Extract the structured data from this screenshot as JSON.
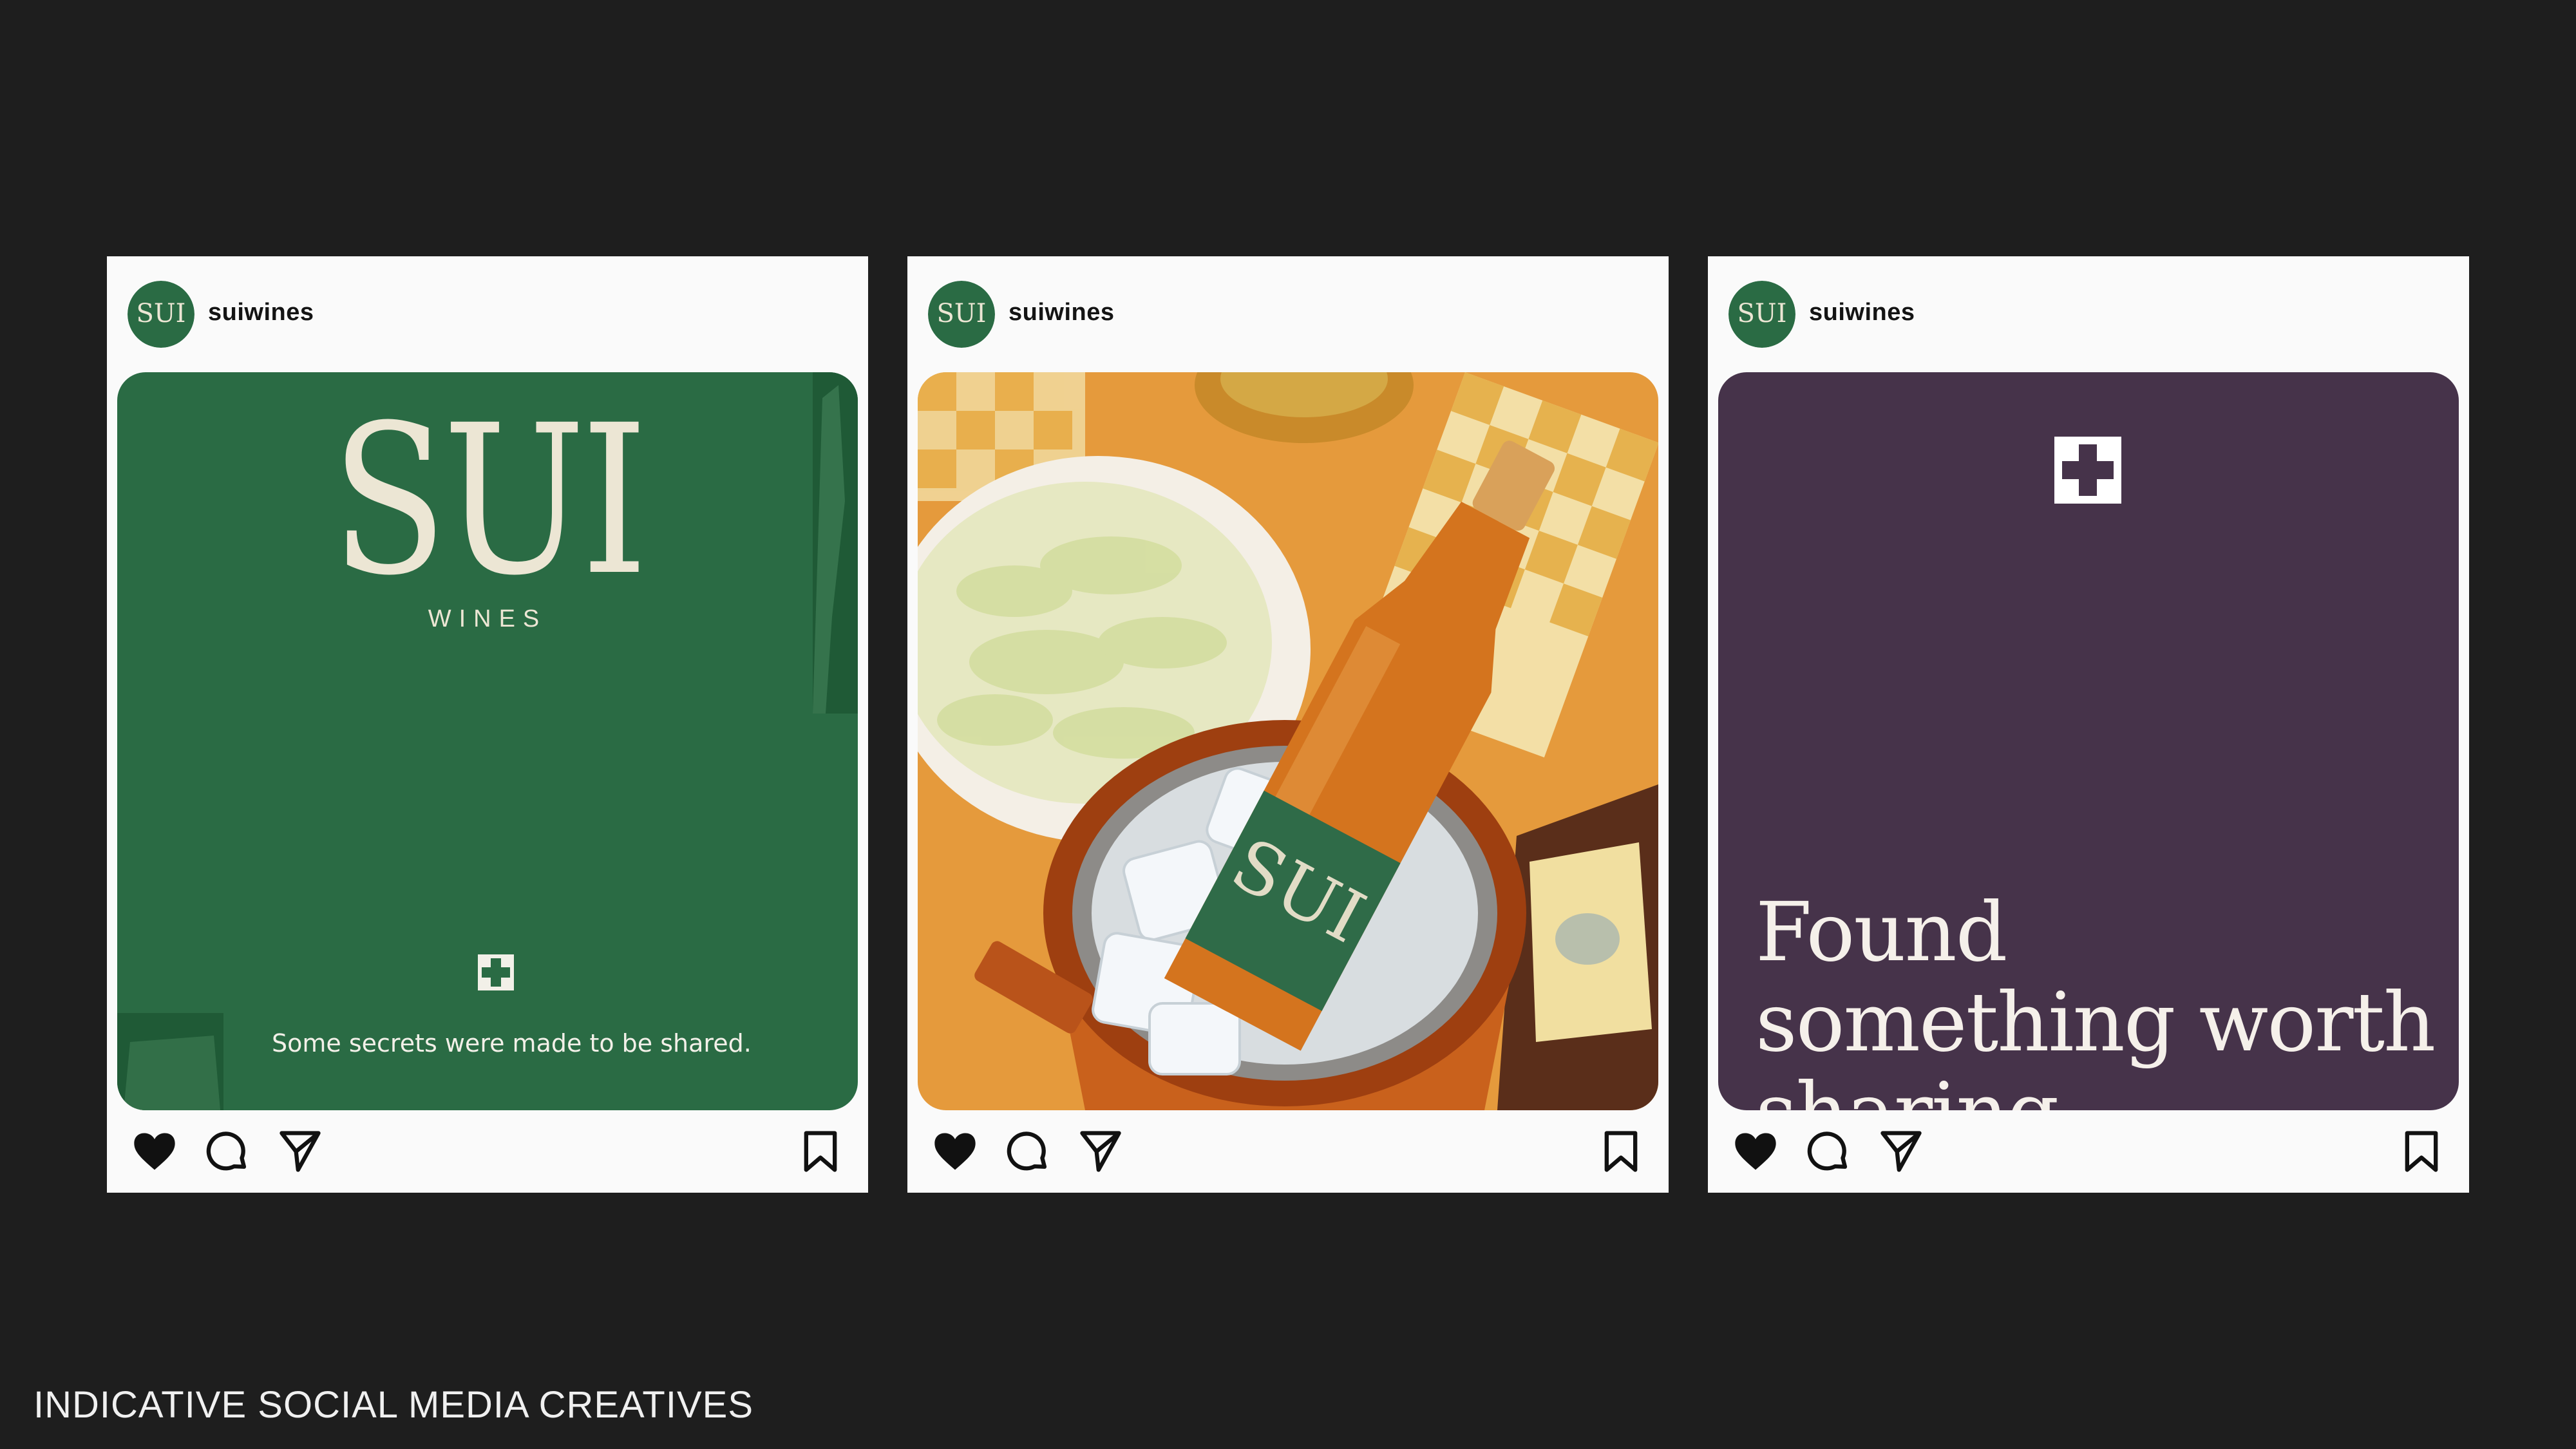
{
  "posts": [
    {
      "username": "suiwines",
      "caption": "Some secrets were made to be shared.",
      "brand_word": "SUI",
      "brand_sub": "WINES"
    },
    {
      "username": "suiwines",
      "image": "wine-bottle-in-ice-bucket-photo"
    },
    {
      "username": "suiwines",
      "headline": "Found something worth sharing."
    }
  ],
  "avatar_text": "SUI",
  "footer": {
    "caption": "INDICATIVE SOCIAL MEDIA CREATIVES"
  },
  "icons": [
    "heart-icon",
    "comment-icon",
    "share-icon",
    "bookmark-icon"
  ],
  "colors": {
    "background": "#1e1e1e",
    "brand_green": "#2a6b44",
    "brand_purple": "#46334a",
    "cream": "#ece6d4"
  }
}
